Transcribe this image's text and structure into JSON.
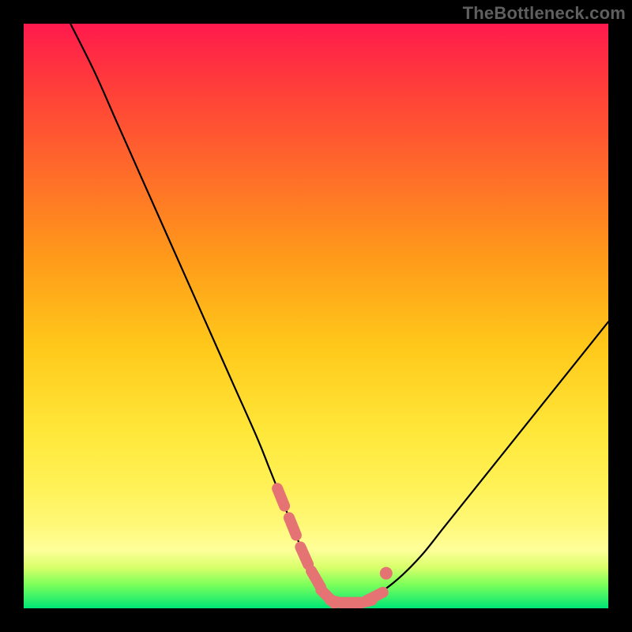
{
  "watermark": "TheBottleneck.com",
  "chart_data": {
    "type": "line",
    "title": "",
    "xlabel": "",
    "ylabel": "",
    "xlim": [
      0,
      100
    ],
    "ylim": [
      0,
      100
    ],
    "x": [
      8,
      12,
      16,
      20,
      24,
      28,
      32,
      36,
      40,
      42,
      44,
      46,
      48,
      50,
      52,
      54,
      56,
      58,
      60,
      64,
      68,
      72,
      76,
      80,
      84,
      88,
      92,
      96,
      100
    ],
    "values": [
      100,
      92,
      83,
      74,
      65,
      56,
      47,
      38,
      29,
      24,
      19,
      14,
      9,
      5,
      2,
      1,
      1,
      1,
      2,
      5,
      9,
      14,
      19,
      24,
      29,
      34,
      39,
      44,
      49
    ],
    "series": [
      {
        "name": "bottleneck-curve",
        "x": [
          8,
          12,
          16,
          20,
          24,
          28,
          32,
          36,
          40,
          42,
          44,
          46,
          48,
          50,
          52,
          54,
          56,
          58,
          60,
          64,
          68,
          72,
          76,
          80,
          84,
          88,
          92,
          96,
          100
        ],
        "values": [
          100,
          92,
          83,
          74,
          65,
          56,
          47,
          38,
          29,
          24,
          19,
          14,
          9,
          5,
          2,
          1,
          1,
          1,
          2,
          5,
          9,
          14,
          19,
          24,
          29,
          34,
          39,
          44,
          49
        ]
      }
    ],
    "highlight": {
      "x": [
        44,
        46,
        48,
        50,
        52,
        54,
        56,
        58,
        60
      ],
      "values": [
        19,
        14,
        9,
        5,
        2,
        1,
        1,
        1,
        2
      ]
    },
    "colors": {
      "curve": "#000000",
      "highlight": "#e57373",
      "gradient_top": "#ff1a4d",
      "gradient_bottom": "#00e676"
    }
  }
}
